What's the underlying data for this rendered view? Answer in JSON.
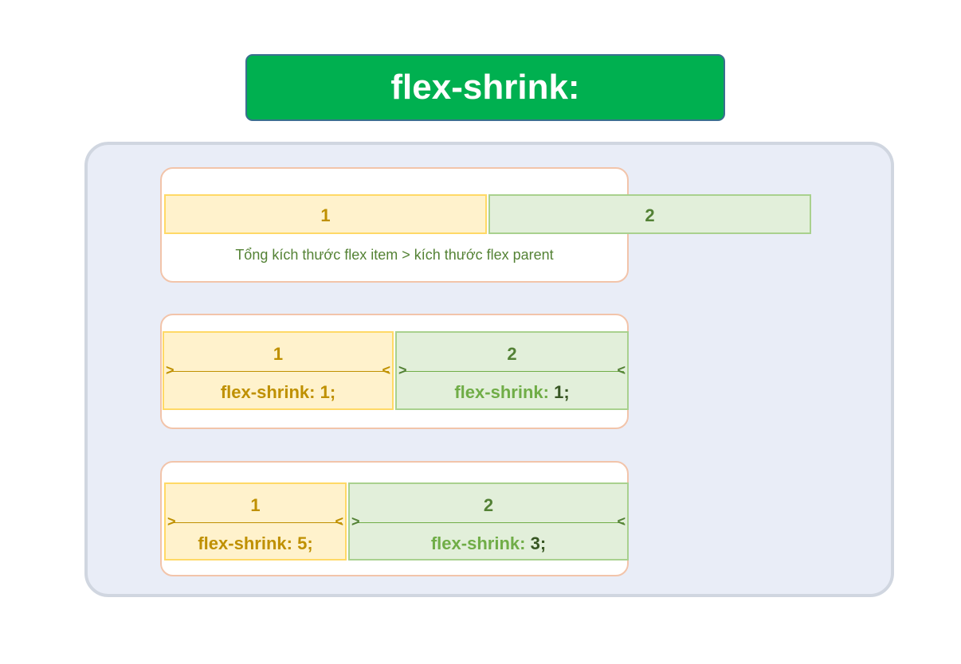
{
  "title": "flex-shrink:",
  "example1": {
    "item1": "1",
    "item2": "2",
    "caption": "Tổng kích thước flex item > kích thước flex parent"
  },
  "example2": {
    "item1": {
      "label": "1",
      "prop_name": "flex-shrink:",
      "prop_value": "1;"
    },
    "item2": {
      "label": "2",
      "prop_name": "flex-shrink:",
      "prop_value": "1;"
    }
  },
  "example3": {
    "item1": {
      "label": "1",
      "prop_name": "flex-shrink:",
      "prop_value": "5;"
    },
    "item2": {
      "label": "2",
      "prop_name": "flex-shrink:",
      "prop_value": "3;"
    }
  },
  "arrow_left": ">",
  "arrow_right": "<",
  "colors": {
    "title_bg": "#00b050",
    "item_yellow": "#fff2cc",
    "item_green": "#e2efda",
    "canvas_bg": "#e9edf7"
  }
}
